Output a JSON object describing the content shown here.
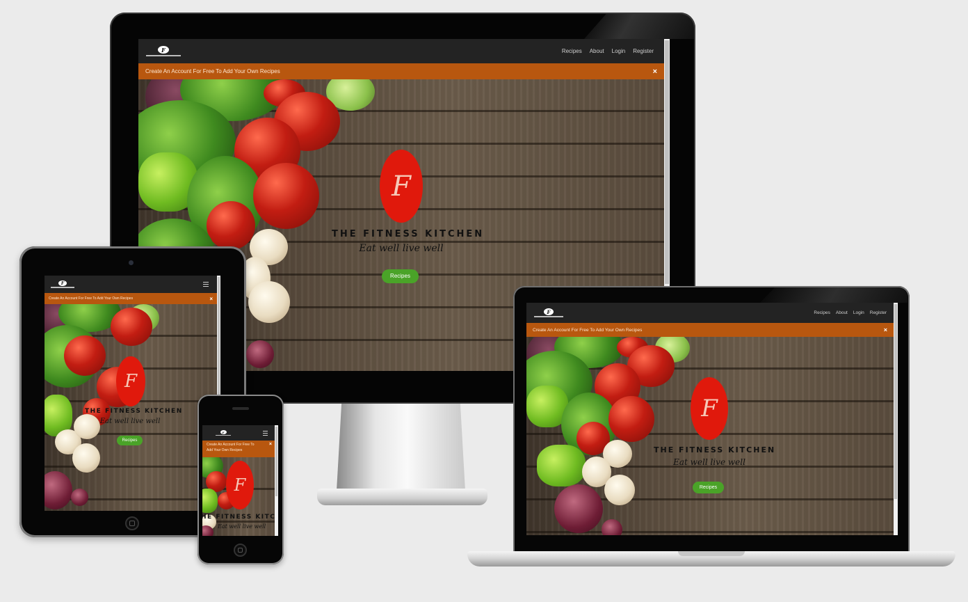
{
  "site": {
    "nav": {
      "recipes": "Recipes",
      "about": "About",
      "login": "Login",
      "register": "Register"
    },
    "logo_mark": "F",
    "alert": {
      "text": "Create An Account For Free To Add Your Own Recipes",
      "phone_line1": "Create An Account For Free To",
      "phone_line2": "Add Your Own Recipes",
      "close": "×"
    },
    "hero": {
      "logo_letter": "F",
      "title": "THE FITNESS KITCHEN",
      "phone_title": "HE FITNESS KITCHE",
      "tagline": "Eat well live well",
      "button": "Recipes"
    }
  },
  "colors": {
    "nav_bg": "#232323",
    "alert_bg": "#b8570f",
    "logo_red": "#e0190c",
    "button_green": "#4aa328",
    "page_bg": "#ebebeb"
  },
  "icons": {
    "close": "close-icon",
    "menu": "hamburger-menu-icon",
    "logo": "fitness-kitchen-logo-icon"
  }
}
